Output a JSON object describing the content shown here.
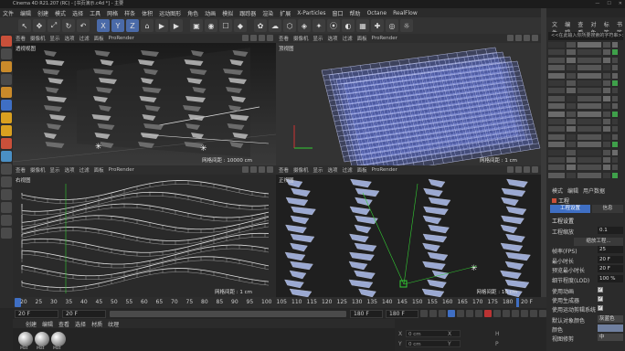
{
  "window": {
    "title": "Cinema 4D R21.207 (RC) - [书页演示.c4d *] - 主要",
    "min": "—",
    "max": "☐",
    "close": "✕"
  },
  "menu": [
    "文件",
    "编辑",
    "创建",
    "模式",
    "选择",
    "工具",
    "网格",
    "样条",
    "体积",
    "运动图形",
    "角色",
    "动画",
    "模拟",
    "跟踪器",
    "渲染",
    "扩展",
    "X-Particles",
    "窗口",
    "帮助",
    "Octane",
    "RealFlow"
  ],
  "toolbar": {
    "buttons": [
      "↖",
      "✥",
      "⤢",
      "↻",
      "↶",
      "X",
      "Y",
      "Z",
      "⌂",
      "▶",
      "▶",
      "▣",
      "◉",
      "☐",
      "◆",
      "✿",
      "☁",
      "⬡",
      "◈",
      "✦",
      "⦿",
      "◐",
      "▦",
      "✚",
      "◎",
      "☼"
    ]
  },
  "viewports": [
    {
      "label": "透视视图",
      "grid": "网格间距 : 10000 cm",
      "menu": [
        "查看",
        "摄像机",
        "显示",
        "选项",
        "过滤",
        "面板",
        "ProRender"
      ]
    },
    {
      "label": "顶视图",
      "grid": "网格间距 : 1 cm",
      "menu": [
        "查看",
        "摄像机",
        "显示",
        "选项",
        "过滤",
        "面板",
        "ProRender"
      ]
    },
    {
      "label": "右视图",
      "grid": "网格间距 : 1 cm",
      "menu": [
        "查看",
        "摄像机",
        "显示",
        "选项",
        "过滤",
        "面板",
        "ProRender"
      ]
    },
    {
      "label": "正视图",
      "grid": "网格间距 : 10 cm",
      "menu": [
        "查看",
        "摄像机",
        "显示",
        "选项",
        "过滤",
        "面板",
        "ProRender"
      ]
    }
  ],
  "timeline": {
    "ticks": [
      "20",
      "25",
      "30",
      "35",
      "40",
      "45",
      "50",
      "55",
      "60",
      "65",
      "70",
      "75",
      "80",
      "85",
      "90",
      "95",
      "100",
      "105",
      "110",
      "115",
      "120",
      "125",
      "130",
      "135",
      "140",
      "145",
      "150",
      "155",
      "160",
      "165",
      "170",
      "175",
      "180"
    ],
    "end_label": "20 F"
  },
  "frames": {
    "current": "20 F",
    "start": "20 F",
    "end": "180 F",
    "end2": "180 F"
  },
  "material_menu": [
    "创建",
    "编辑",
    "查看",
    "选择",
    "材质",
    "纹理"
  ],
  "materials": [
    "Mat",
    "Mat",
    "Mat"
  ],
  "coords": {
    "x": "X",
    "y": "Y",
    "z": "Z",
    "x_val": "0 cm",
    "y_val": "0 cm",
    "z_val": "0 cm",
    "h": "H",
    "p": "P",
    "b": "B",
    "x2": "X",
    "y2": "Y",
    "z2": "Z"
  },
  "object_manager": {
    "tabs": [
      "文件",
      "编辑",
      "查看",
      "对象",
      "标签",
      "书签"
    ],
    "search": "<<在此输入你所要搜索的字符串>>"
  },
  "attributes": {
    "tabs": [
      "模式",
      "编辑",
      "用户数据"
    ],
    "object": "工程",
    "subtabs": [
      "工程设置",
      "信息"
    ],
    "section": "工程设置",
    "rows": [
      {
        "label": "工程缩放",
        "value": "0.1"
      },
      {
        "label": "缩放工程...",
        "value": ""
      },
      {
        "label": "帧率(FPS)",
        "value": "25"
      },
      {
        "label": "最小时长",
        "value": "20 F"
      },
      {
        "label": "预览最小时长",
        "value": "20 F"
      },
      {
        "label": "细节程度(LOD)",
        "value": "100 %"
      }
    ],
    "checks": [
      {
        "label": "使用动画",
        "value": "✓"
      },
      {
        "label": "使用生成器",
        "value": "✓"
      },
      {
        "label": "使用运动剪辑系统",
        "value": "✓"
      }
    ],
    "default_color": {
      "label": "默认对象颜色",
      "value": "灰蓝色"
    },
    "color": "颜色",
    "view_clip": {
      "label": "视图修剪",
      "value": "中"
    }
  },
  "colors": {
    "accent": "#3f6fc4",
    "mesh": "#8fa6ff"
  }
}
